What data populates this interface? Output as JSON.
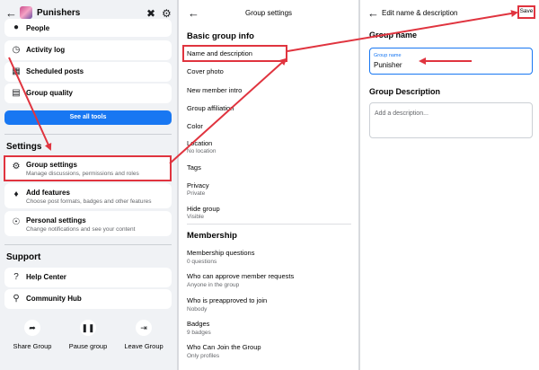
{
  "panel1": {
    "title": "Punishers",
    "rows": [
      {
        "icon": "people-icon",
        "label": "People"
      },
      {
        "icon": "clock-icon",
        "label": "Activity log"
      },
      {
        "icon": "calendar-icon",
        "label": "Scheduled posts"
      },
      {
        "icon": "clipboard-icon",
        "label": "Group quality"
      }
    ],
    "see_all": "See all tools",
    "settings_heading": "Settings",
    "settings_rows": [
      {
        "icon": "gear-icon",
        "label": "Group settings",
        "sub": "Manage discussions, permissions and roles"
      },
      {
        "icon": "features-icon",
        "label": "Add features",
        "sub": "Choose post formats, badges and other features"
      },
      {
        "icon": "personal-settings-icon",
        "label": "Personal settings",
        "sub": "Change notifications and see your content"
      }
    ],
    "support_heading": "Support",
    "support_rows": [
      {
        "icon": "question-icon",
        "label": "Help Center"
      },
      {
        "icon": "lightbulb-icon",
        "label": "Community Hub"
      }
    ],
    "actions": [
      {
        "icon": "share-icon",
        "label": "Share Group"
      },
      {
        "icon": "pause-icon",
        "label": "Pause group"
      },
      {
        "icon": "leave-icon",
        "label": "Leave Group"
      }
    ]
  },
  "panel2": {
    "title": "Group settings",
    "basic_heading": "Basic group info",
    "basic_items": [
      {
        "label": "Name and description",
        "sub": ""
      },
      {
        "label": "Cover photo",
        "sub": ""
      },
      {
        "label": "New member intro",
        "sub": ""
      },
      {
        "label": "Group affiliation",
        "sub": ""
      },
      {
        "label": "Color",
        "sub": ""
      },
      {
        "label": "Location",
        "sub": "No location"
      },
      {
        "label": "Tags",
        "sub": ""
      },
      {
        "label": "Privacy",
        "sub": "Private"
      },
      {
        "label": "Hide group",
        "sub": "Visible"
      }
    ],
    "membership_heading": "Membership",
    "membership_items": [
      {
        "label": "Membership questions",
        "sub": "0 questions"
      },
      {
        "label": "Who can approve member requests",
        "sub": "Anyone in the group"
      },
      {
        "label": "Who is preapproved to join",
        "sub": "Nobody"
      },
      {
        "label": "Badges",
        "sub": "9 badges"
      },
      {
        "label": "Who Can Join the Group",
        "sub": "Only profiles"
      }
    ]
  },
  "panel3": {
    "title": "Edit name & description",
    "save": "Save",
    "group_name_heading": "Group name",
    "group_name_label": "Group name",
    "group_name_value": "Punisher",
    "description_heading": "Group Description",
    "description_placeholder": "Add a description..."
  },
  "colors": {
    "accent": "#1877f2",
    "highlight": "#e0343f",
    "panel_bg": "#f0f2f5"
  }
}
